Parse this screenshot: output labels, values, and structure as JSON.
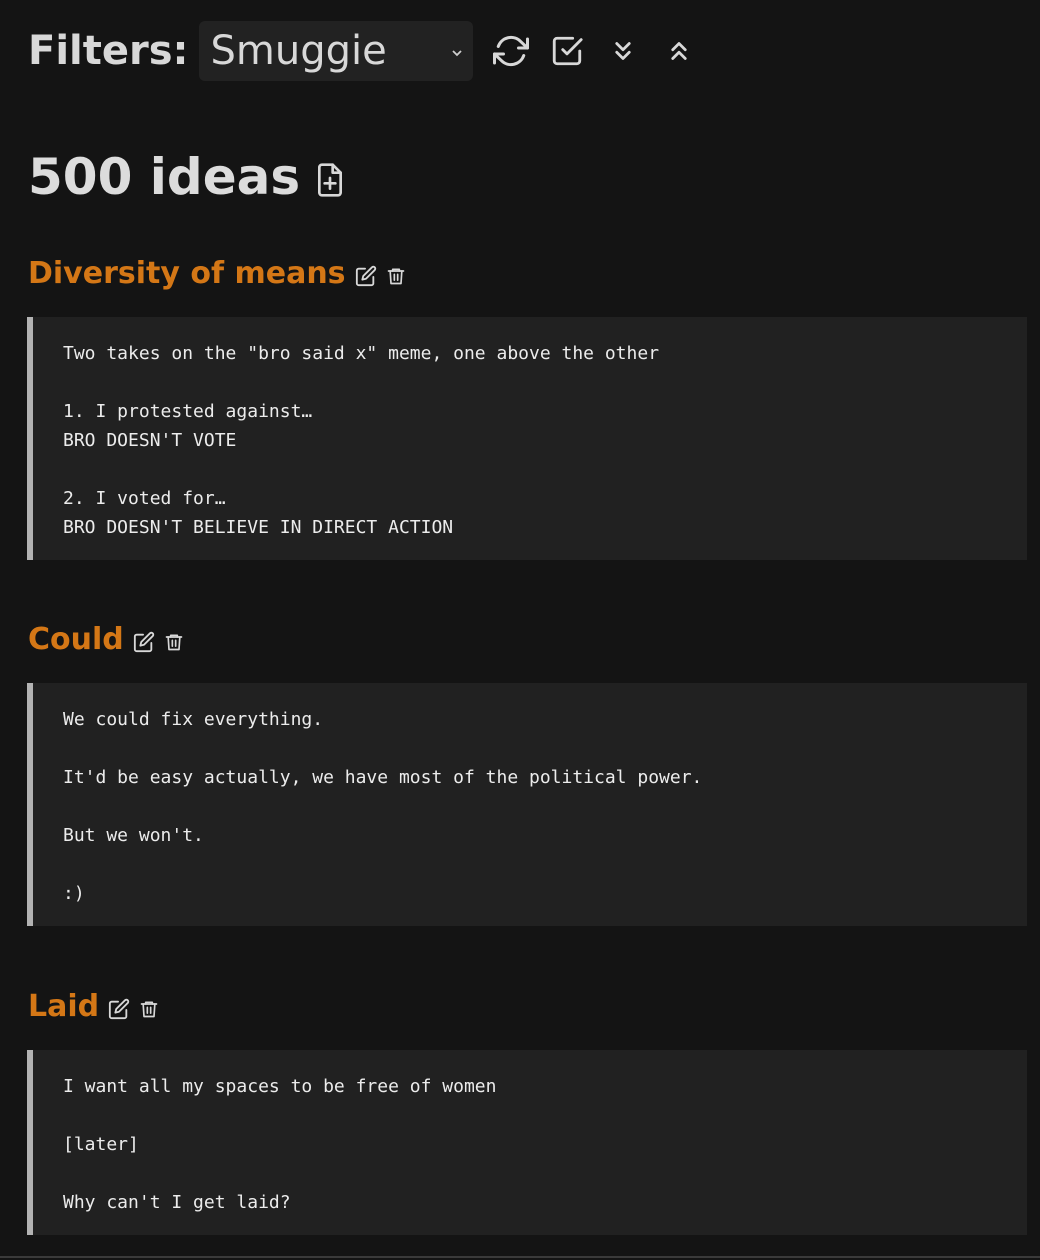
{
  "toolbar": {
    "label": "Filters:",
    "filter_value": "Smuggie",
    "icons": [
      "refresh-icon",
      "check-square-icon",
      "chevrons-down-icon",
      "chevrons-up-icon"
    ]
  },
  "count": {
    "title": "500 ideas",
    "icon": "file-plus-icon"
  },
  "colors": {
    "background": "#141414",
    "accent": "#d47716",
    "card": "#212121",
    "card_border": "#b3b3b3"
  },
  "ideas": [
    {
      "title": "Diversity of means",
      "text": "Two takes on the \"bro said x\" meme, one above the other\n\n1. I protested against…\nBRO DOESN'T VOTE\n\n2. I voted for…\nBRO DOESN'T BELIEVE IN DIRECT ACTION"
    },
    {
      "title": "Could",
      "text": "We could fix everything.\n\nIt'd be easy actually, we have most of the political power.\n\nBut we won't.\n\n:)"
    },
    {
      "title": "Laid",
      "text": "I want all my spaces to be free of women\n\n[later]\n\nWhy can't I get laid?"
    }
  ]
}
